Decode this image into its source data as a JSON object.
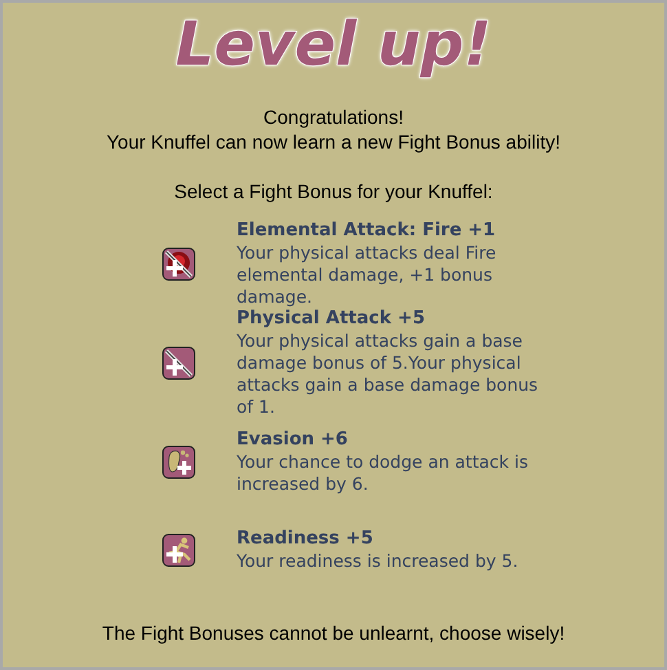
{
  "title": "Level up!",
  "intro": [
    "Congratulations!",
    "Your Knuffel can now learn a new Fight Bonus ability!"
  ],
  "prompt": "Select a Fight Bonus for your Knuffel:",
  "bonuses": [
    {
      "kind": "fire",
      "name": "Elemental Attack: Fire +1",
      "description": "Your physical attacks deal Fire elemental damage, +1 bonus damage."
    },
    {
      "kind": "physical",
      "name": "Physical Attack +5",
      "description": "Your physical attacks gain a base damage bonus of 5.Your physical attacks gain a base damage bonus of 1."
    },
    {
      "kind": "evasion",
      "name": "Evasion +6",
      "description": "Your chance to dodge an attack is increased by 6."
    },
    {
      "kind": "readiness",
      "name": "Readiness +5",
      "description": "Your readiness is increased by 5."
    }
  ],
  "warning": "The Fight Bonuses cannot be unlearnt, choose wisely!"
}
